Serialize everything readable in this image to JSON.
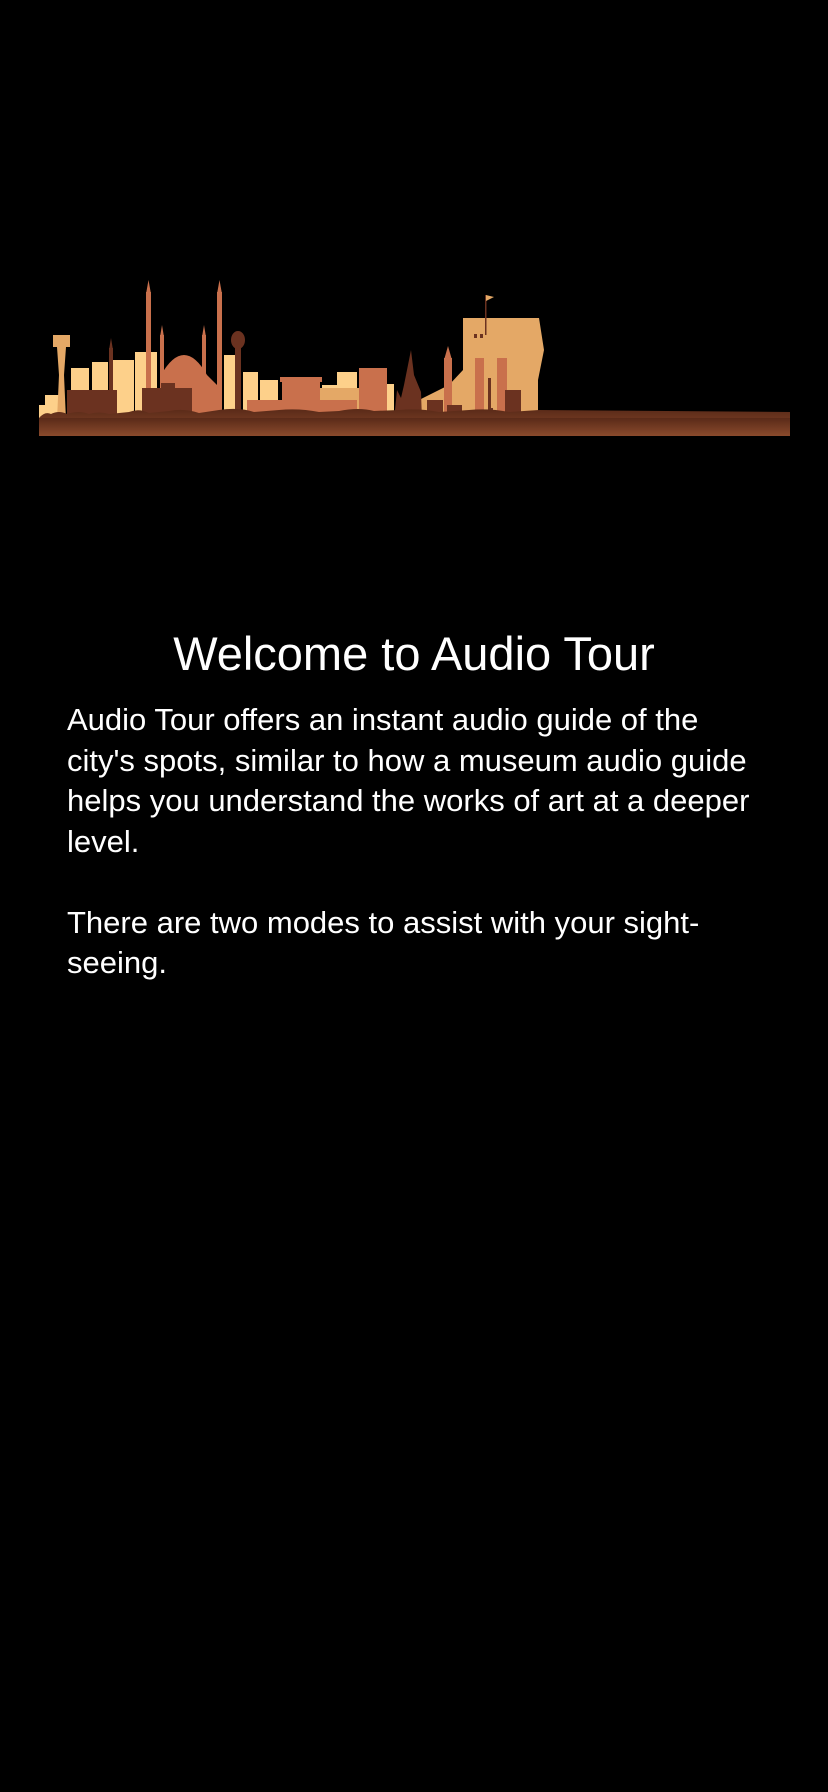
{
  "header_image": {
    "icon": "city-skyline-illustration",
    "colors": {
      "light": "#fdd08a",
      "mid": "#e4a866",
      "accent": "#c9704c",
      "dark": "#6b3220"
    }
  },
  "welcome": {
    "title": "Welcome to Audio Tour",
    "paragraphs": [
      "Audio Tour offers an instant audio guide of the city's spots, similar to how a museum audio guide helps you understand the works of art at a deeper level.",
      "There are two modes to assist with your sight-seeing."
    ]
  }
}
